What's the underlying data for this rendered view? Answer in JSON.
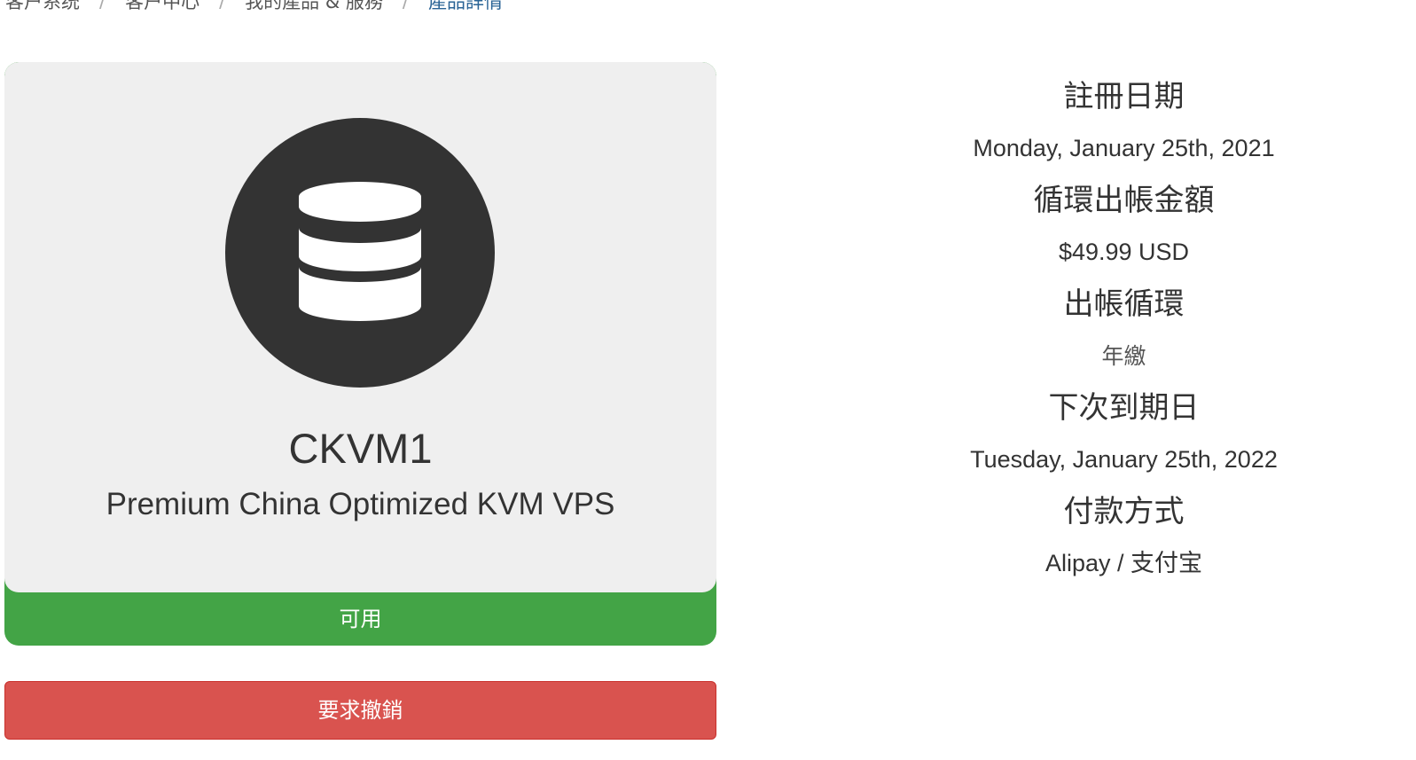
{
  "breadcrumb": {
    "items": [
      "客户系统",
      "客户中心",
      "我的產品 & 服務",
      "產品詳情"
    ],
    "separator": "/"
  },
  "product": {
    "icon": "database-icon",
    "name": "CKVM1",
    "group": "Premium China Optimized KVM VPS",
    "status": "可用",
    "status_color": "#43a446"
  },
  "actions": {
    "cancel_label": "要求撤銷",
    "cancel_color": "#d9534f"
  },
  "details": {
    "registration_date_label": "註冊日期",
    "registration_date": "Monday, January 25th, 2021",
    "recurring_amount_label": "循環出帳金額",
    "recurring_amount": "$49.99 USD",
    "billing_cycle_label": "出帳循環",
    "billing_cycle": "年繳",
    "next_due_date_label": "下次到期日",
    "next_due_date": "Tuesday, January 25th, 2022",
    "payment_method_label": "付款方式",
    "payment_method": "Alipay / 支付宝"
  }
}
